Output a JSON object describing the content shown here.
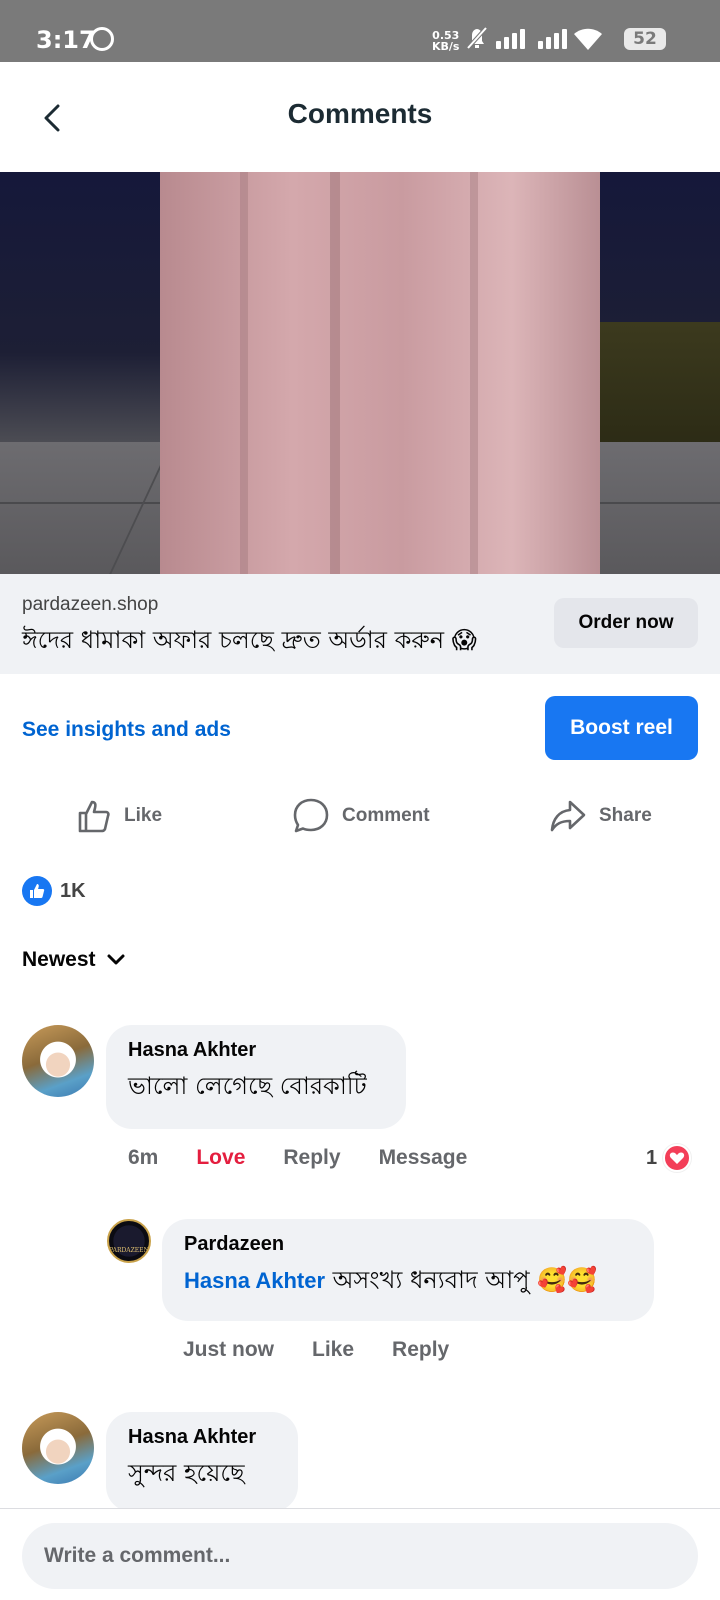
{
  "status_bar": {
    "time": "3:17",
    "net_speed_value": "0.53",
    "net_speed_unit": "KB/s",
    "battery": "52",
    "icons": [
      "dnd-circle-icon",
      "mute-icon",
      "signal-icon",
      "signal-icon",
      "wifi-icon",
      "battery-icon"
    ]
  },
  "header": {
    "title": "Comments",
    "back_icon": "chevron-left-icon"
  },
  "ad": {
    "domain": "pardazeen.shop",
    "text": "ঈদের ধামাকা অফার চলছে দ্রুত অর্ডার করুন 😱",
    "cta": "Order now"
  },
  "insights": {
    "link": "See insights and ads",
    "boost": "Boost reel"
  },
  "actions": {
    "like": "Like",
    "comment": "Comment",
    "share": "Share"
  },
  "reactions": {
    "count": "1K"
  },
  "sort": {
    "label": "Newest"
  },
  "comments": [
    {
      "name": "Hasna Akhter",
      "text": "ভালো লেগেছে বোরকাটি",
      "time": "6m",
      "reaction_label": "Love",
      "reply": "Reply",
      "message": "Message",
      "reaction_count": "1",
      "replies": [
        {
          "name": "Pardazeen",
          "avatar_text": "PARDAZEEN",
          "mention": "Hasna Akhter",
          "text": " অসংখ্য ধন্যবাদ আপু 🥰🥰",
          "time": "Just now",
          "like": "Like",
          "reply": "Reply"
        }
      ]
    },
    {
      "name": "Hasna Akhter",
      "text": "সুন্দর হয়েছে"
    }
  ],
  "composer": {
    "placeholder": "Write a comment..."
  },
  "colors": {
    "accent": "#1877f2",
    "link": "#0064d1",
    "love": "#e41e3f"
  }
}
